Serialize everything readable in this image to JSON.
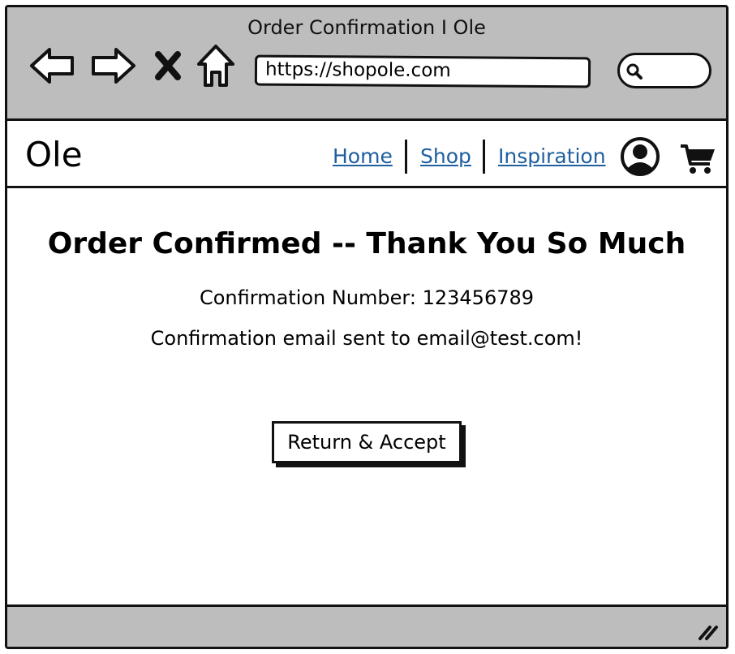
{
  "browser": {
    "title": "Order Confirmation I Ole",
    "url": "https://shopole.com",
    "icons": [
      "back-arrow-icon",
      "forward-arrow-icon",
      "close-icon",
      "home-icon",
      "search-icon"
    ]
  },
  "header": {
    "logo": "Ole",
    "nav": [
      {
        "label": "Home"
      },
      {
        "label": "Shop"
      },
      {
        "label": "Inspiration"
      }
    ],
    "icons": [
      "user-account-icon",
      "shopping-cart-icon"
    ]
  },
  "main": {
    "heading": "Order Confirmed -- Thank You So Much",
    "confirmation_number": "Confirmation Number: 123456789",
    "email_message": "Confirmation email sent to email@test.com!",
    "button_label": "Return & Accept"
  },
  "colors": {
    "chrome": "#bdbdbd",
    "link": "#1f5fa0",
    "outline": "#111111"
  }
}
